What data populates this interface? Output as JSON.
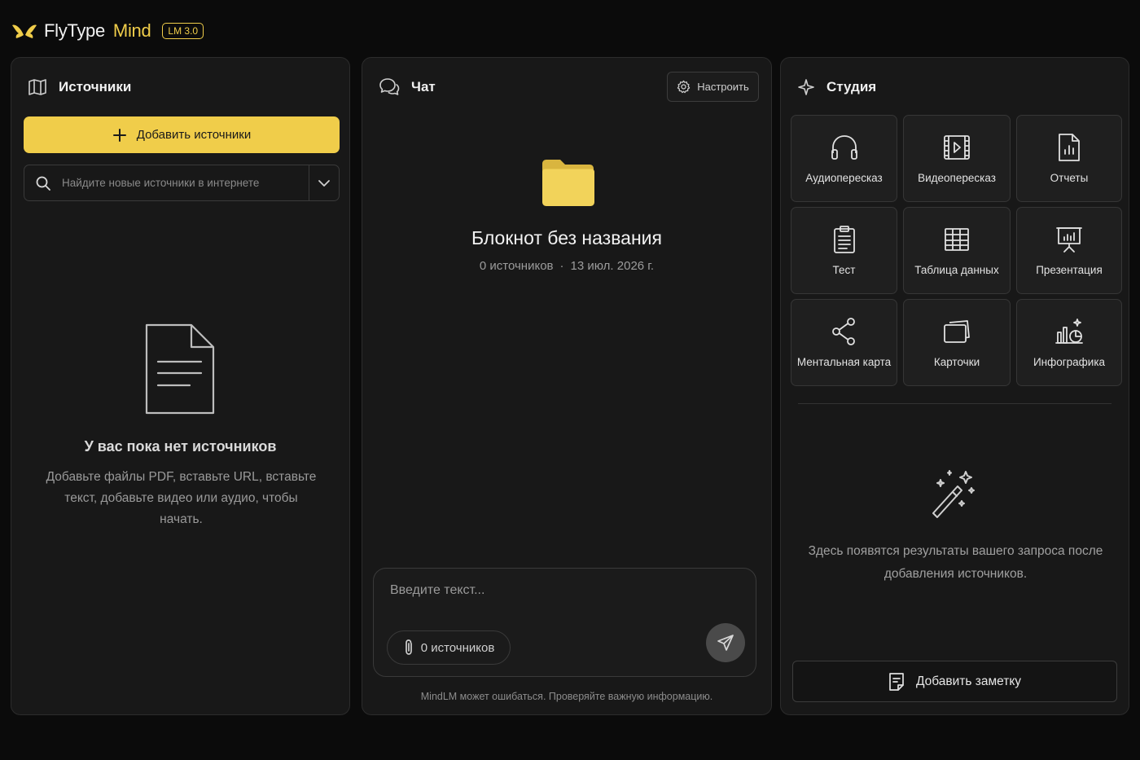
{
  "brand": {
    "name": "FlyType",
    "sub": "Mind",
    "badge": "LM 3.0",
    "logo_icon": "butterfly-logo"
  },
  "sources": {
    "title": "Источники",
    "title_icon": "book-open-icon",
    "add_label": "Добавить источники",
    "search_placeholder": "Найдите новые источники в интернете",
    "empty_title": "У вас пока нет источников",
    "empty_desc": "Добавьте файлы PDF, вставьте URL, вставьте текст, добавьте видео или аудио, чтобы начать."
  },
  "chat": {
    "title": "Чат",
    "title_icon": "chat-bubbles-icon",
    "config_label": "Настроить",
    "notebook_title": "Блокнот без названия",
    "source_count": "0 источников",
    "separator": "·",
    "date": "13 июл. 2026 г.",
    "input_placeholder": "Введите текст...",
    "chip_label": "0 источников",
    "disclaimer": "MindLM может ошибаться. Проверяйте важную информацию."
  },
  "studio": {
    "title": "Студия",
    "title_icon": "sparkle-icon",
    "tiles": [
      {
        "label": "Аудиопересказ",
        "icon": "headphones-icon"
      },
      {
        "label": "Видеопересказ",
        "icon": "film-icon"
      },
      {
        "label": "Отчеты",
        "icon": "report-icon"
      },
      {
        "label": "Тест",
        "icon": "clipboard-icon"
      },
      {
        "label": "Таблица данных",
        "icon": "table-icon"
      },
      {
        "label": "Презентация",
        "icon": "presentation-icon"
      },
      {
        "label": "Ментальная карта",
        "icon": "share-nodes-icon"
      },
      {
        "label": "Карточки",
        "icon": "cards-icon"
      },
      {
        "label": "Инфографика",
        "icon": "infographic-icon"
      }
    ],
    "empty_message": "Здесь появятся результаты вашего запроса после добавления источников.",
    "note_label": "Добавить заметку"
  },
  "colors": {
    "accent": "#f0cd4a",
    "background": "#0b0b0b",
    "panel": "#181818"
  }
}
